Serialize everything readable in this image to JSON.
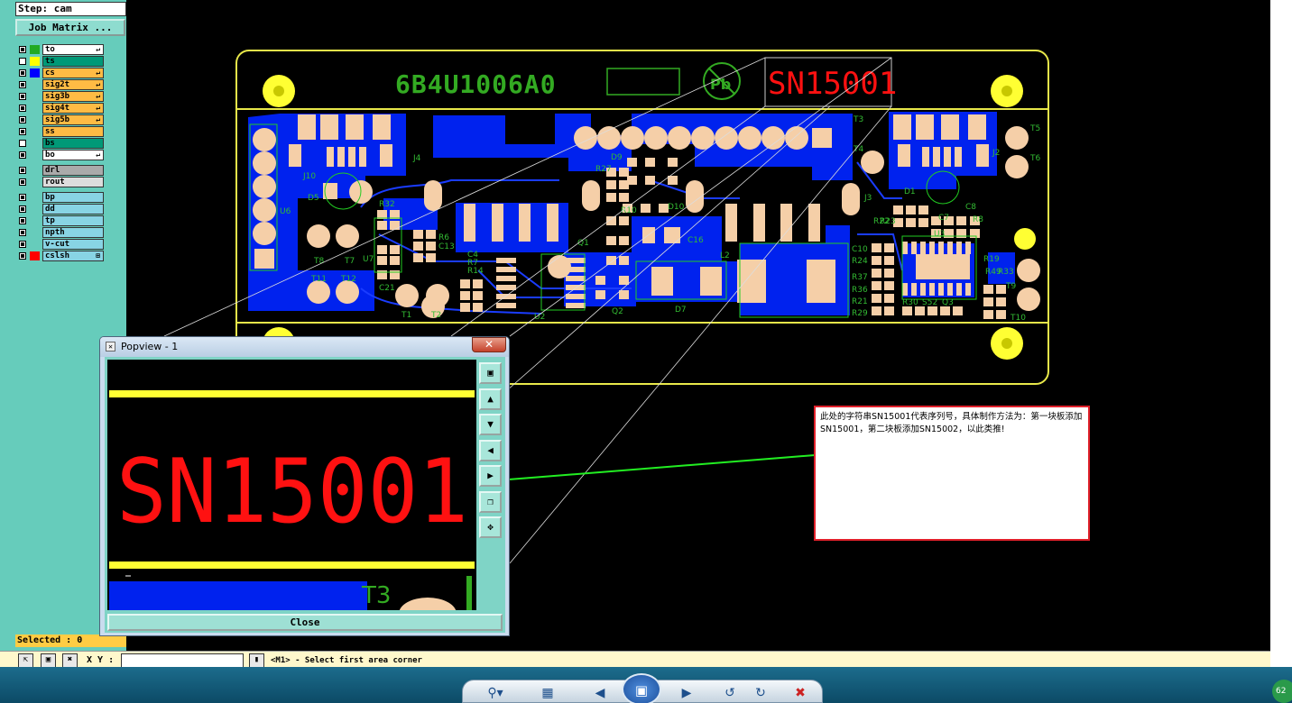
{
  "step_label": "Step: cam",
  "job_matrix_label": "Job Matrix ...",
  "layers": [
    {
      "name": "to",
      "color": "#22aa22",
      "bg": "#ffffff",
      "checked": true,
      "arrow": "↵"
    },
    {
      "name": "ts",
      "color": "#ffff00",
      "bg": "#009977",
      "checked": false,
      "arrow": ""
    },
    {
      "name": "cs",
      "color": "#0000ff",
      "bg": "#ffbb44",
      "checked": true,
      "arrow": "↵"
    },
    {
      "name": "sig2t",
      "color": "#66ccbb",
      "bg": "#ffbb44",
      "checked": true,
      "arrow": "↵"
    },
    {
      "name": "sig3b",
      "color": "#66ccbb",
      "bg": "#ffbb44",
      "checked": true,
      "arrow": "↵"
    },
    {
      "name": "sig4t",
      "color": "#66ccbb",
      "bg": "#ffbb44",
      "checked": true,
      "arrow": "↵"
    },
    {
      "name": "sig5b",
      "color": "#66ccbb",
      "bg": "#ffbb44",
      "checked": true,
      "arrow": "↵"
    },
    {
      "name": "ss",
      "color": "#66ccbb",
      "bg": "#ffbb44",
      "checked": true,
      "arrow": ""
    },
    {
      "name": "bs",
      "color": "#66ccbb",
      "bg": "#009977",
      "checked": false,
      "arrow": ""
    },
    {
      "name": "bo",
      "color": "#66ccbb",
      "bg": "#ffffff",
      "checked": true,
      "arrow": "↵"
    },
    {
      "name": "drl",
      "color": "#66ccbb",
      "bg": "#aaaaaa",
      "checked": true,
      "arrow": ""
    },
    {
      "name": "rout",
      "color": "#66ccbb",
      "bg": "#dddddd",
      "checked": true,
      "arrow": ""
    },
    {
      "name": "bp",
      "color": "#66ccbb",
      "bg": "#88d4e4",
      "checked": true,
      "arrow": ""
    },
    {
      "name": "dd",
      "color": "#66ccbb",
      "bg": "#88d4e4",
      "checked": true,
      "arrow": ""
    },
    {
      "name": "tp",
      "color": "#66ccbb",
      "bg": "#88d4e4",
      "checked": true,
      "arrow": ""
    },
    {
      "name": "npth",
      "color": "#66ccbb",
      "bg": "#88d4e4",
      "checked": true,
      "arrow": ""
    },
    {
      "name": "v-cut",
      "color": "#66ccbb",
      "bg": "#88d4e4",
      "checked": true,
      "arrow": ""
    },
    {
      "name": "cslsh",
      "color": "#ff0000",
      "bg": "#88d4e4",
      "checked": true,
      "arrow": "⊞"
    }
  ],
  "selected_label": "Selected : 0",
  "status": {
    "xy_label": "X Y :",
    "message": "<M1> - Select first area corner"
  },
  "pcb": {
    "board_code": "6B4U1006A0",
    "serial_text": "SN15001",
    "refdes": [
      "J10",
      "D5",
      "J4",
      "D9",
      "R32",
      "U6",
      "U7",
      "R6",
      "C13",
      "C4",
      "R7",
      "R14",
      "T8",
      "T7",
      "T11",
      "T12",
      "C21",
      "T1",
      "T2",
      "Q1",
      "U2",
      "Q2",
      "D10",
      "C16",
      "R27",
      "R10",
      "L2",
      "D7",
      "J3",
      "D1",
      "U3",
      "R22",
      "R23",
      "C10",
      "R24",
      "R37",
      "R36",
      "R21",
      "R29",
      "R30",
      "R19",
      "R49",
      "R33",
      "T3",
      "T4",
      "T5",
      "T6",
      "J2",
      "T9",
      "T10",
      "C7",
      "C8",
      "R8",
      "S52",
      "Q3"
    ]
  },
  "popview": {
    "title": "Popview - 1",
    "close_x": "✕",
    "zoom_text": "SN15001",
    "fragment_text": "T3",
    "close_label": "Close",
    "tools": [
      "zoom-fit-icon",
      "zoom-in-icon",
      "zoom-out-icon",
      "pan-left-icon",
      "pan-right-icon",
      "expand-icon",
      "center-icon"
    ]
  },
  "note": {
    "text": "此处的字符串SN15001代表序列号，具体制作方法为：第一块板添加SN15001，第二块板添加SN15002，以此类推!"
  },
  "taskbar": {
    "zoom_badge": "62"
  }
}
